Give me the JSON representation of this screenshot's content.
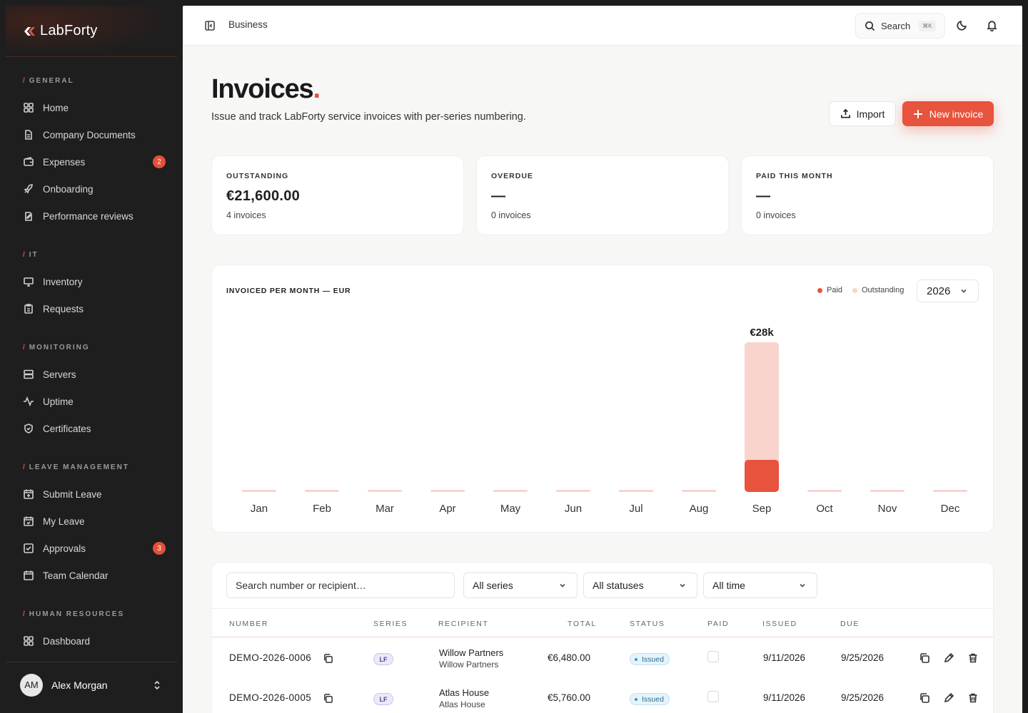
{
  "brand": {
    "name": "LabForty"
  },
  "sidebar": {
    "sections": [
      {
        "label": "GENERAL"
      },
      {
        "label": "IT"
      },
      {
        "label": "MONITORING"
      },
      {
        "label": "LEAVE MANAGEMENT"
      },
      {
        "label": "HUMAN RESOURCES"
      }
    ],
    "items": [
      {
        "label": "Home",
        "icon": "grid-icon"
      },
      {
        "label": "Company Documents",
        "icon": "document-icon"
      },
      {
        "label": "Expenses",
        "icon": "wallet-icon",
        "badge": "2"
      },
      {
        "label": "Onboarding",
        "icon": "rocket-icon"
      },
      {
        "label": "Performance reviews",
        "icon": "review-icon"
      },
      {
        "label": "Inventory",
        "icon": "monitor-icon"
      },
      {
        "label": "Requests",
        "icon": "clipboard-icon"
      },
      {
        "label": "Servers",
        "icon": "server-icon"
      },
      {
        "label": "Uptime",
        "icon": "activity-icon"
      },
      {
        "label": "Certificates",
        "icon": "shield-icon"
      },
      {
        "label": "Submit Leave",
        "icon": "calendar-plus-icon"
      },
      {
        "label": "My Leave",
        "icon": "calendar-icon"
      },
      {
        "label": "Approvals",
        "icon": "check-square-icon",
        "badge": "3"
      },
      {
        "label": "Team Calendar",
        "icon": "calendar-icon"
      },
      {
        "label": "Dashboard",
        "icon": "grid-icon"
      }
    ],
    "user": {
      "initials": "AM",
      "name": "Alex Morgan"
    }
  },
  "topbar": {
    "breadcrumb": "Business",
    "search_label": "Search",
    "shortcut": "⌘K"
  },
  "header": {
    "title": "Invoices",
    "title_dot": ".",
    "subtitle": "Issue and track LabForty service invoices with per-series numbering.",
    "import_label": "Import",
    "new_label": "New invoice"
  },
  "stats": [
    {
      "label": "OUTSTANDING",
      "value": "€21,600.00",
      "sub": "4 invoices"
    },
    {
      "label": "OVERDUE",
      "value": "—",
      "sub": "0 invoices"
    },
    {
      "label": "PAID THIS MONTH",
      "value": "—",
      "sub": "0 invoices"
    }
  ],
  "chart_data": {
    "type": "bar",
    "title": "INVOICED PER MONTH — EUR",
    "categories": [
      "Jan",
      "Feb",
      "Mar",
      "Apr",
      "May",
      "Jun",
      "Jul",
      "Aug",
      "Sep",
      "Oct",
      "Nov",
      "Dec"
    ],
    "series": [
      {
        "name": "Paid",
        "values": [
          0,
          0,
          0,
          0,
          0,
          0,
          0,
          0,
          6,
          0,
          0,
          0
        ],
        "color": "#e8533d"
      },
      {
        "name": "Outstanding",
        "values": [
          0,
          0,
          0,
          0,
          0,
          0,
          0,
          0,
          22,
          0,
          0,
          0
        ],
        "color": "#f9d4cd"
      }
    ],
    "stacked": true,
    "units": "thousand EUR",
    "data_labels": [
      {
        "category": "Sep",
        "text": "€28k"
      }
    ],
    "legend_position": "top-right",
    "grid": false,
    "year": "2026"
  },
  "filters": {
    "search_placeholder": "Search number or recipient…",
    "series": "All series",
    "status": "All statuses",
    "time": "All time"
  },
  "table": {
    "columns": [
      "NUMBER",
      "SERIES",
      "RECIPIENT",
      "TOTAL",
      "STATUS",
      "PAID",
      "ISSUED",
      "DUE"
    ],
    "rows": [
      {
        "number": "DEMO-2026-0006",
        "series": "LF",
        "recipient": "Willow Partners",
        "recipient_sub": "Willow Partners",
        "total": "€6,480.00",
        "status": "Issued",
        "issued": "9/11/2026",
        "due": "9/25/2026"
      },
      {
        "number": "DEMO-2026-0005",
        "series": "LF",
        "recipient": "Atlas House",
        "recipient_sub": "Atlas House",
        "total": "€5,760.00",
        "status": "Issued",
        "issued": "9/11/2026",
        "due": "9/25/2026"
      }
    ]
  },
  "colors": {
    "accent": "#e8533d",
    "outstanding": "#f9d4cd",
    "sidebar": "#1e1e1e"
  }
}
